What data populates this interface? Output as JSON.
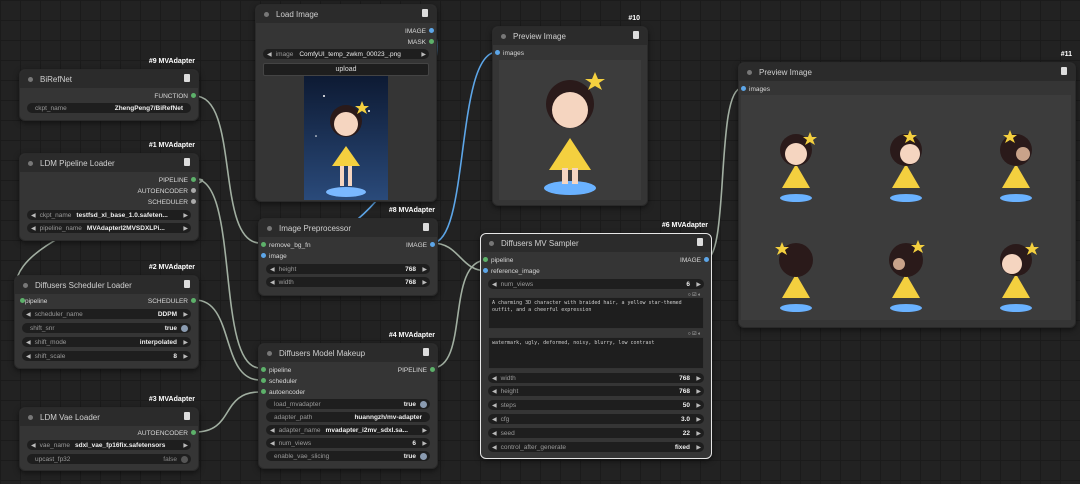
{
  "nodes": {
    "birefnet": {
      "badge": "#9 MVAdapter",
      "title": "BiRefNet",
      "output": "FUNCTION",
      "widget": {
        "label": "ckpt_name",
        "value": "ZhengPeng7/BiRefNet"
      }
    },
    "ldm_pipeline": {
      "badge": "#1 MVAdapter",
      "title": "LDM Pipeline Loader",
      "outputs": [
        "PIPELINE",
        "AUTOENCODER",
        "SCHEDULER"
      ],
      "widgets": [
        {
          "label": "ckpt_name",
          "value": "testfsd_xl_base_1.0.safeten..."
        },
        {
          "label": "pipeline_name",
          "value": "MVAdapterI2MVSDXLPi..."
        }
      ]
    },
    "scheduler": {
      "badge": "#2 MVAdapter",
      "title": "Diffusers Scheduler Loader",
      "input": "pipeline",
      "output": "SCHEDULER",
      "widgets": [
        {
          "label": "scheduler_name",
          "value": "DDPM"
        },
        {
          "label": "shift_snr",
          "value": "true"
        },
        {
          "label": "shift_mode",
          "value": "interpolated"
        },
        {
          "label": "shift_scale",
          "value": "8"
        }
      ]
    },
    "vae": {
      "badge": "#3 MVAdapter",
      "title": "LDM Vae Loader",
      "output": "AUTOENCODER",
      "widgets": [
        {
          "label": "vae_name",
          "value": "sdxl_vae_fp16fix.safetensors"
        },
        {
          "label": "upcast_fp32",
          "value": "false"
        }
      ]
    },
    "load_image": {
      "title": "Load Image",
      "outputs": [
        "IMAGE",
        "MASK"
      ],
      "widget": {
        "label": "image",
        "value": "ComfyUI_temp_zwkm_00023_.png"
      },
      "button": "upload"
    },
    "preprocessor": {
      "badge": "#8 MVAdapter",
      "title": "Image Preprocessor",
      "inputs": [
        "remove_bg_fn",
        "image"
      ],
      "output": "IMAGE",
      "widgets": [
        {
          "label": "height",
          "value": "768"
        },
        {
          "label": "width",
          "value": "768"
        }
      ]
    },
    "makeup": {
      "badge": "#4 MVAdapter",
      "title": "Diffusers Model Makeup",
      "inputs": [
        "pipeline",
        "scheduler",
        "autoencoder"
      ],
      "output": "PIPELINE",
      "widgets": [
        {
          "label": "load_mvadapter",
          "value": "true"
        },
        {
          "label": "adapter_path",
          "value": "huanngzh/mv-adapter"
        },
        {
          "label": "adapter_name",
          "value": "mvadapter_i2mv_sdxl.sa..."
        },
        {
          "label": "num_views",
          "value": "6"
        },
        {
          "label": "enable_vae_slicing",
          "value": "true"
        }
      ]
    },
    "preview1": {
      "badge": "#10",
      "title": "Preview Image",
      "input": "images"
    },
    "sampler": {
      "badge": "#6 MVAdapter",
      "title": "Diffusers MV Sampler",
      "inputs": [
        "pipeline",
        "reference_image"
      ],
      "output": "IMAGE",
      "num_views": {
        "label": "num_views",
        "value": "6"
      },
      "prompt": "A charming 3D character with braided hair, a yellow star-themed outfit, and a cheerful expression",
      "negative": "watermark, ugly, deformed, noisy, blurry, low contrast",
      "widgets": [
        {
          "label": "width",
          "value": "768"
        },
        {
          "label": "height",
          "value": "768"
        },
        {
          "label": "steps",
          "value": "50"
        },
        {
          "label": "cfg",
          "value": "3.0"
        },
        {
          "label": "seed",
          "value": "22"
        },
        {
          "label": "control_after_generate",
          "value": "fixed"
        }
      ]
    },
    "preview2": {
      "badge": "#11",
      "title": "Preview Image",
      "input": "images"
    }
  },
  "colors": {
    "bg": "#222222",
    "node": "#353535",
    "header": "#2b2b2b",
    "green_slot": "#5db16a",
    "blue_slot": "#5da6e8",
    "wire": "#b9c9b9",
    "wire_blue": "#5da6e8"
  }
}
